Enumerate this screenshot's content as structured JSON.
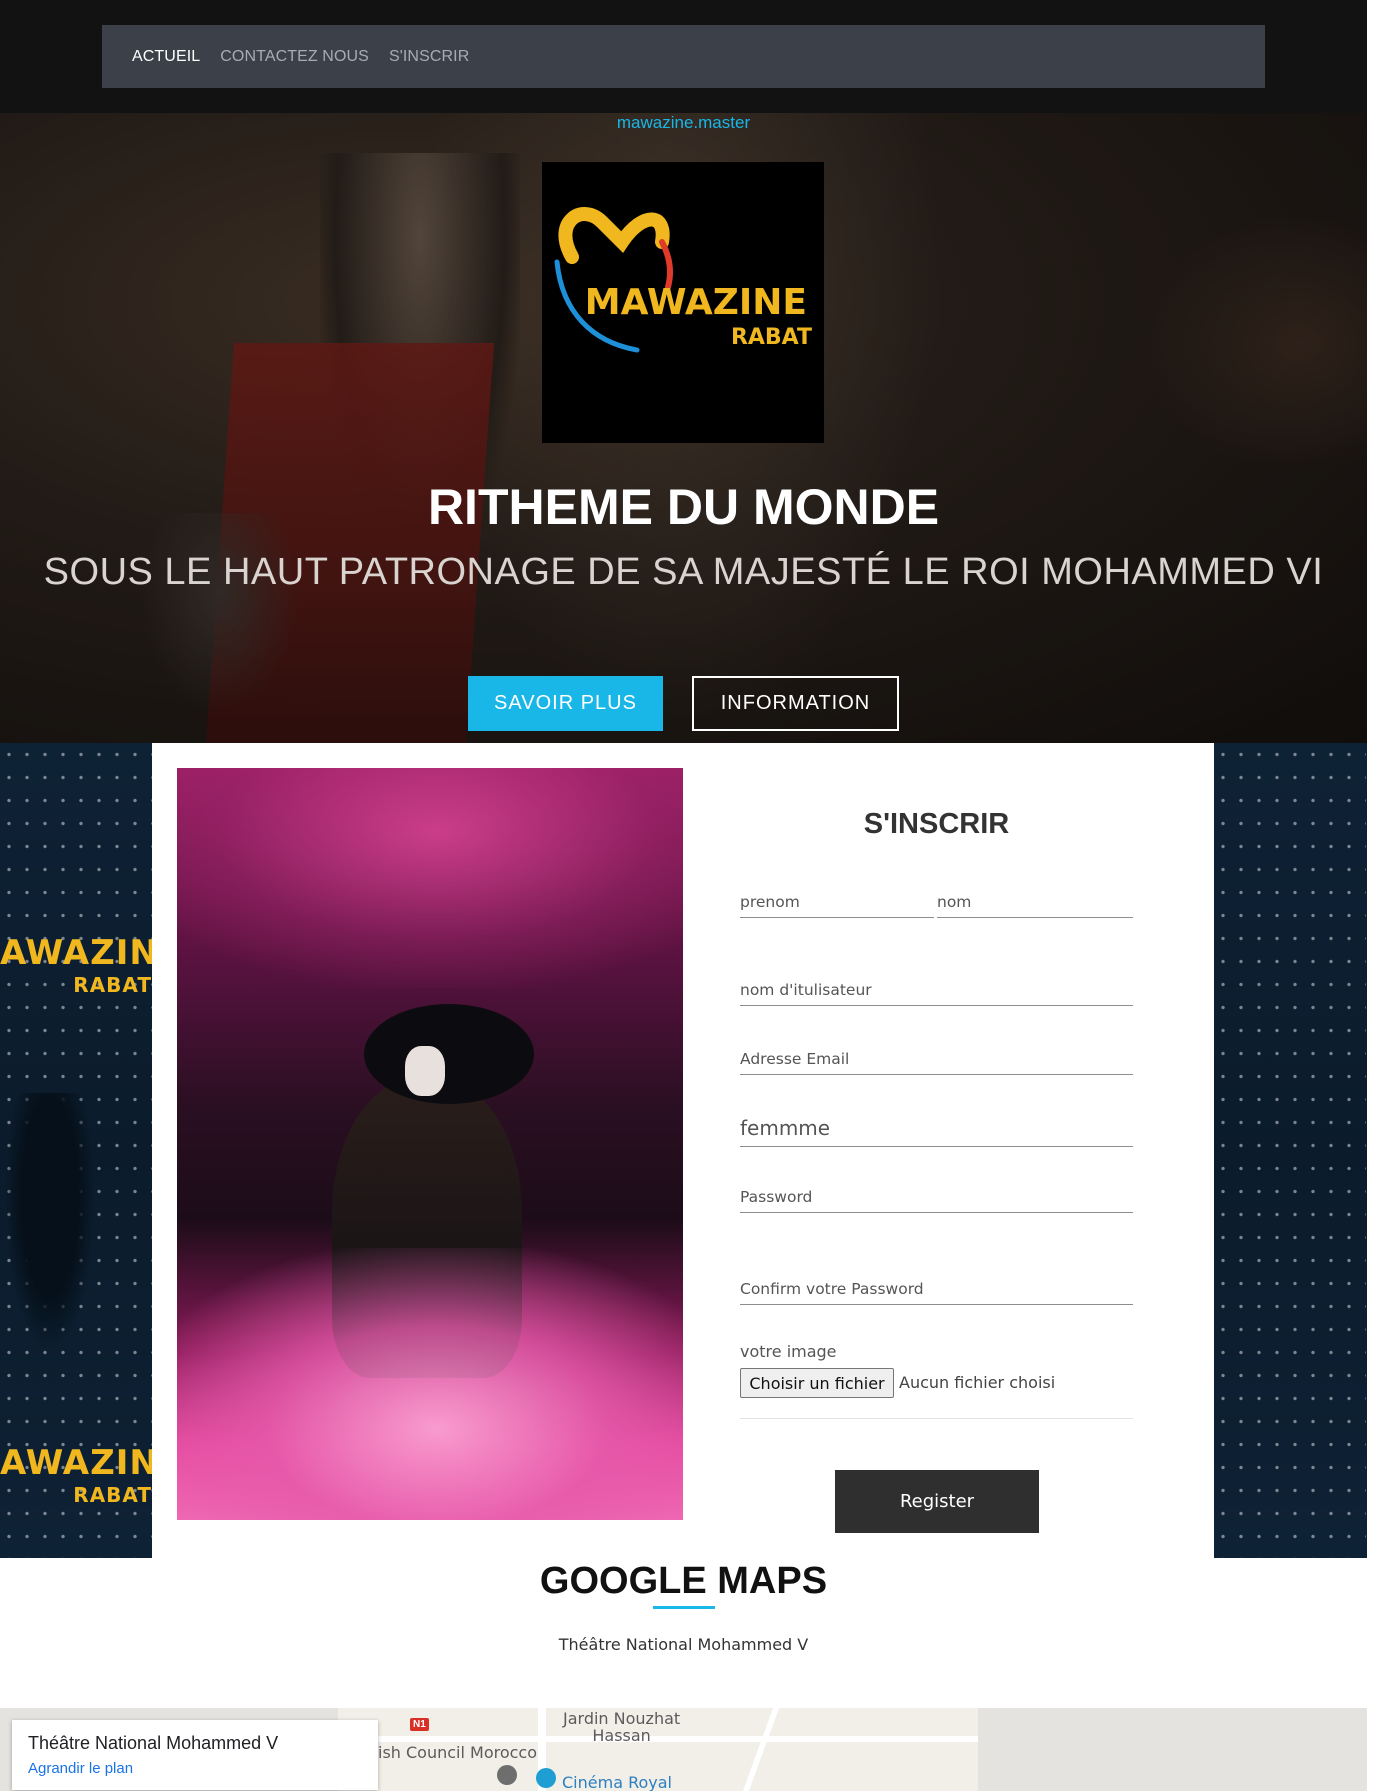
{
  "nav": {
    "items": [
      {
        "label": "ACTUEIL",
        "active": true
      },
      {
        "label": "CONTACTEZ NOUS",
        "active": false
      },
      {
        "label": "S'INSCRIR",
        "active": false
      }
    ]
  },
  "hero": {
    "site_name": "mawazine.master",
    "logo": {
      "line1": "MAWAZINE",
      "line2": "RABAT"
    },
    "title": "RITHEME DU MONDE",
    "subtitle": "SOUS LE HAUT PATRONAGE DE SA MAJESTÉ LE ROI MOHAMMED VI",
    "primary_button": "SAVOIR PLUS",
    "secondary_button": "INFORMATION"
  },
  "side_banner": {
    "logo_line1": "AWAZINE",
    "logo_line2": "RABAT"
  },
  "form": {
    "title": "S'INSCRIR",
    "fields": {
      "prenom": {
        "placeholder": "prenom"
      },
      "nom": {
        "placeholder": "nom"
      },
      "username": {
        "placeholder": "nom d'itulisateur"
      },
      "email": {
        "placeholder": "Adresse Email"
      },
      "gender": {
        "value": "femmme"
      },
      "password": {
        "placeholder": "Password"
      },
      "confirm": {
        "placeholder": "Confirm votre Password"
      }
    },
    "image_label": "votre image",
    "file_button": "Choisir un fichier",
    "file_status": "Aucun fichier choisi",
    "submit": "Register"
  },
  "maps": {
    "title": "GOOGLE MAPS",
    "subtitle": "Théâtre National Mohammed V",
    "card_title": "Théâtre National Mohammed V",
    "card_link": "Agrandir le plan",
    "labels": {
      "garden": "Jardin Nouzhat\nHassan",
      "council": "ish Council Morocco",
      "cinema": "Cinéma Royal",
      "road_badge": "N1"
    }
  },
  "colors": {
    "accent": "#18b7e8",
    "nav_bg": "#3c4049",
    "topbar_bg": "#121212",
    "register_bg": "#2f2f2f",
    "logo_yellow": "#f0b81e"
  }
}
